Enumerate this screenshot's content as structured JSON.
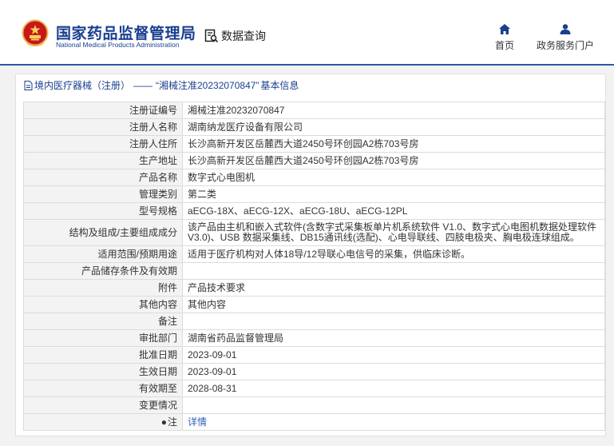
{
  "header": {
    "site_title": "国家药品监督管理局",
    "site_subtitle": "National Medical Products Administration",
    "query_label": "数据查询",
    "nav": {
      "home": "首页",
      "service": "政务服务门户"
    }
  },
  "breadcrumb": {
    "category": "境内医疗器械（注册）",
    "separator": "——",
    "record": "“湘械注准20232070847”",
    "suffix": "基本信息"
  },
  "record": {
    "rows": [
      {
        "label": "注册证编号",
        "value": "湘械注准20232070847"
      },
      {
        "label": "注册人名称",
        "value": "湖南纳龙医疗设备有限公司"
      },
      {
        "label": "注册人住所",
        "value": "长沙高新开发区岳麓西大道2450号环创园A2栋703号房"
      },
      {
        "label": "生产地址",
        "value": "长沙高新开发区岳麓西大道2450号环创园A2栋703号房"
      },
      {
        "label": "产品名称",
        "value": "数字式心电图机"
      },
      {
        "label": "管理类别",
        "value": "第二类"
      },
      {
        "label": "型号规格",
        "value": "aECG-18X、aECG-12X、aECG-18U、aECG-12PL"
      },
      {
        "label": "结构及组成/主要组成成分",
        "value": "该产品由主机和嵌入式软件(含数字式采集板单片机系统软件 V1.0、数字式心电图机数据处理软件 V3.0)、USB 数据采集线、DB15通讯线(选配)、心电导联线、四肢电极夹、胸电极连球组成。"
      },
      {
        "label": "适用范围/预期用途",
        "value": "适用于医疗机构对人体18导/12导联心电信号的采集，供临床诊断。"
      },
      {
        "label": "产品储存条件及有效期",
        "value": ""
      },
      {
        "label": "附件",
        "value": "产品技术要求"
      },
      {
        "label": "其他内容",
        "value": "其他内容"
      },
      {
        "label": "备注",
        "value": ""
      },
      {
        "label": "审批部门",
        "value": "湖南省药品监督管理局"
      },
      {
        "label": "批准日期",
        "value": "2023-09-01"
      },
      {
        "label": "生效日期",
        "value": "2023-09-01"
      },
      {
        "label": "有效期至",
        "value": "2028-08-31"
      },
      {
        "label": "变更情况",
        "value": ""
      },
      {
        "label": "注",
        "value": "详情"
      }
    ]
  }
}
